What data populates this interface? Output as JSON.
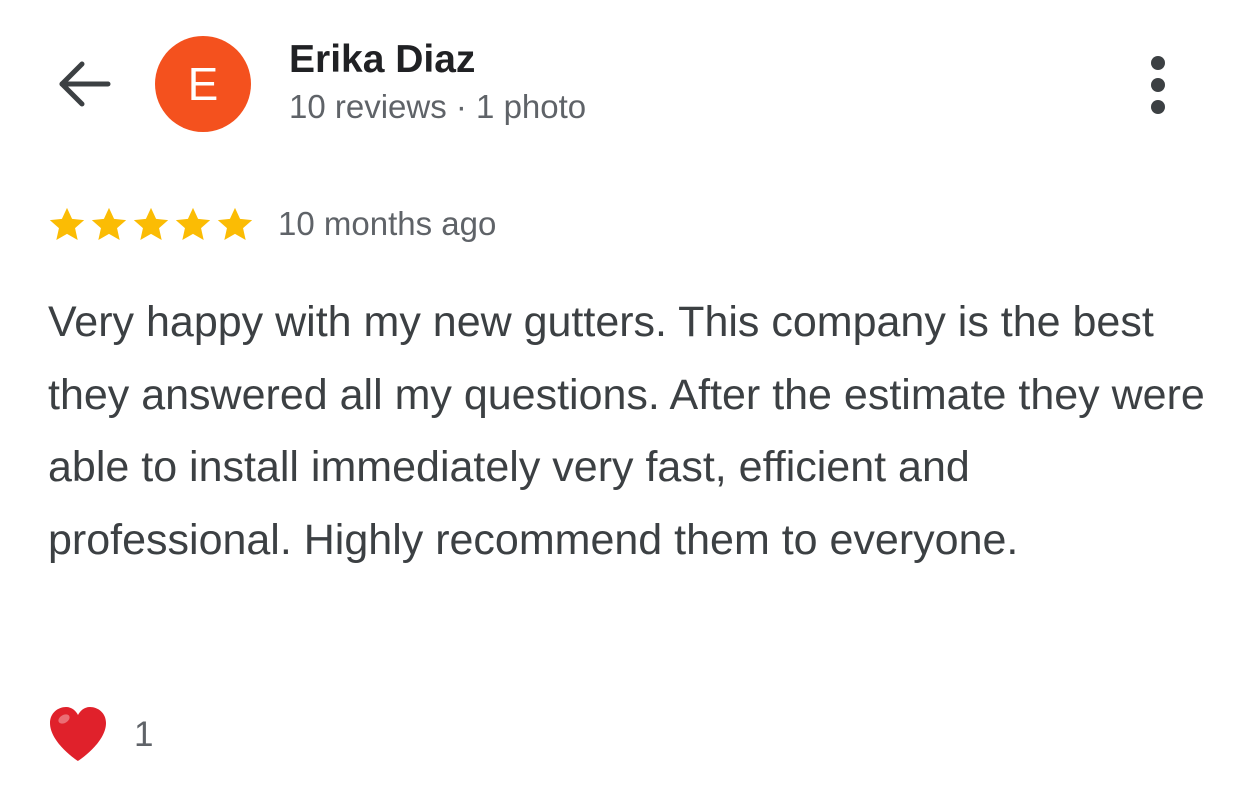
{
  "header": {
    "back_icon": "arrow-left-icon",
    "more_icon": "more-vert-icon"
  },
  "reviewer": {
    "avatar_letter": "E",
    "avatar_color": "#f4511e",
    "name": "Erika Diaz",
    "meta": "10 reviews · 1 photo"
  },
  "review": {
    "rating": 5,
    "star_color": "#fbbc04",
    "time": "10 months ago",
    "text": "Very happy with my new gutters. This company is the best they answered all my questions. After the estimate they were able to install immediately very fast, efficient and professional. Highly recommend them to everyone."
  },
  "reactions": {
    "heart_icon": "heart-icon",
    "heart_color": "#e0212b",
    "count": "1"
  }
}
